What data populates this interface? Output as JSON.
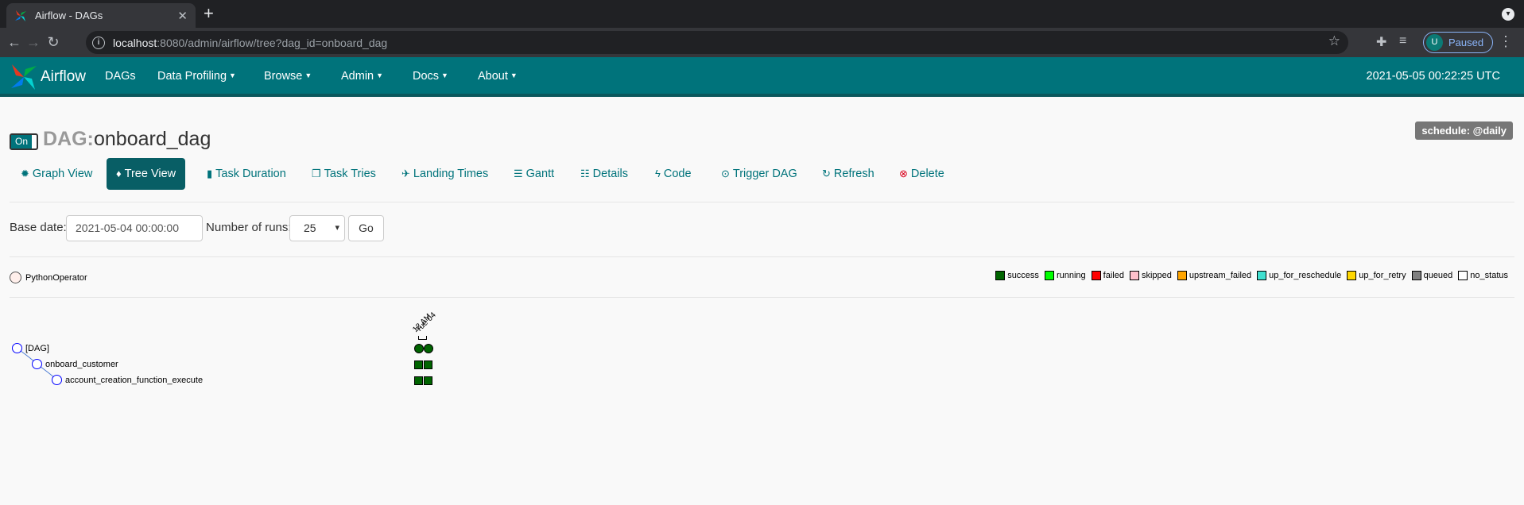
{
  "browser": {
    "tab_title": "Airflow - DAGs",
    "url_host": "localhost",
    "url_rest": ":8080/admin/airflow/tree?dag_id=onboard_dag",
    "profile_initial": "U",
    "profile_status": "Paused"
  },
  "navbar": {
    "brand": "Airflow",
    "items": [
      {
        "label": "DAGs",
        "dropdown": false
      },
      {
        "label": "Data Profiling",
        "dropdown": true
      },
      {
        "label": "Browse",
        "dropdown": true
      },
      {
        "label": "Admin",
        "dropdown": true
      },
      {
        "label": "Docs",
        "dropdown": true
      },
      {
        "label": "About",
        "dropdown": true
      }
    ],
    "clock": "2021-05-05 00:22:25 UTC"
  },
  "dag": {
    "toggle_label": "On",
    "prefix": "DAG:",
    "name": "onboard_dag",
    "schedule": "schedule: @daily"
  },
  "view_tabs": [
    {
      "label": "Graph View",
      "icon": "graph-icon"
    },
    {
      "label": "Tree View",
      "icon": "tree-icon",
      "active": true
    },
    {
      "label": "Task Duration",
      "icon": "bar-chart-icon"
    },
    {
      "label": "Task Tries",
      "icon": "duplicate-icon"
    },
    {
      "label": "Landing Times",
      "icon": "plane-icon"
    },
    {
      "label": "Gantt",
      "icon": "gantt-icon"
    },
    {
      "label": "Details",
      "icon": "list-icon"
    },
    {
      "label": "Code",
      "icon": "flash-icon"
    },
    {
      "label": "Trigger DAG",
      "icon": "play-circle-icon"
    },
    {
      "label": "Refresh",
      "icon": "refresh-icon"
    },
    {
      "label": "Delete",
      "icon": "remove-circle-icon"
    }
  ],
  "filter": {
    "base_date_label": "Base date:",
    "base_date_value": "2021-05-04 00:00:00",
    "runs_label": "Number of runs:",
    "runs_value": "25",
    "go_label": "Go"
  },
  "operator": "PythonOperator",
  "legend": [
    {
      "label": "success",
      "color": "#006400"
    },
    {
      "label": "running",
      "color": "#00ff00"
    },
    {
      "label": "failed",
      "color": "#ff0000"
    },
    {
      "label": "skipped",
      "color": "#ffc0cb"
    },
    {
      "label": "upstream_failed",
      "color": "#ffa500"
    },
    {
      "label": "up_for_reschedule",
      "color": "#40e0d0"
    },
    {
      "label": "up_for_retry",
      "color": "#ffd700"
    },
    {
      "label": "queued",
      "color": "#808080"
    },
    {
      "label": "no_status",
      "color": "#ffffff"
    }
  ],
  "tree": {
    "nodes": [
      "[DAG]",
      "onboard_customer",
      "account_creation_function_execute"
    ],
    "run_labels": [
      "12 AM",
      "Tue 04"
    ]
  },
  "colors": {
    "teal": "#00737b",
    "success": "#006400"
  }
}
